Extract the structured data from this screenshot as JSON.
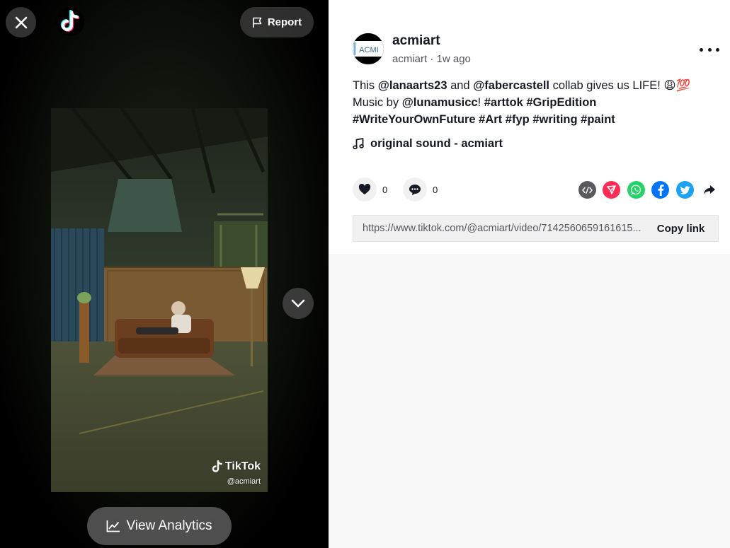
{
  "left_panel": {
    "report_label": "Report",
    "analytics_label": "View Analytics",
    "watermark": {
      "brand": "TikTok",
      "handle": "@acmiart"
    }
  },
  "post": {
    "username": "acmiart",
    "avatar_text": "ACMI",
    "handle": "acmiart",
    "separator": " · ",
    "time_ago": "1w ago",
    "caption": {
      "t1": "This ",
      "m1": "@lanaarts23",
      "t2": " and ",
      "m2": "@fabercastell",
      "t3": " collab gives us LIFE! 😩💯 Music by ",
      "m3": "@lunamusicc",
      "t4": "! ",
      "h1": "#arttok",
      "h2": "#GripEdition",
      "h3": "#WriteYourOwnFuture",
      "h4": "#Art",
      "h5": "#fyp",
      "h6": "#writing",
      "h7": "#paint"
    },
    "sound": "original sound - acmiart",
    "likes": "0",
    "comments": "0",
    "share_icons": [
      "embed-icon",
      "send-to-friends-icon",
      "whatsapp-icon",
      "facebook-icon",
      "twitter-icon",
      "share-arrow-icon"
    ],
    "link_url": "https://www.tiktok.com/@acmiart/video/7142560659161615...",
    "copy_label": "Copy link"
  },
  "colors": {
    "send": "#fe2c55",
    "whatsapp": "#25d366",
    "facebook": "#0075fa",
    "twitter": "#1da1f2",
    "embed": "#5a5a5e"
  }
}
